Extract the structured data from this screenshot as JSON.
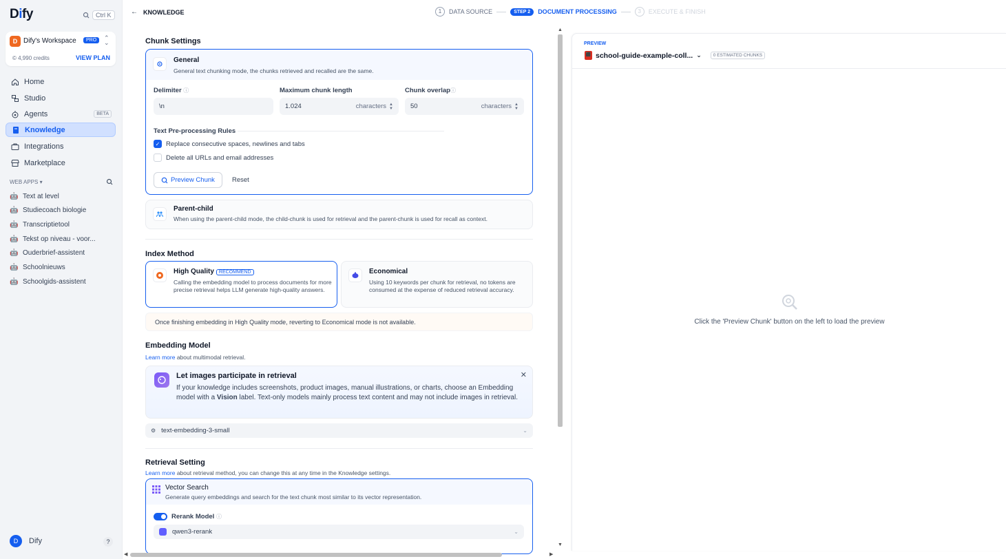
{
  "brand": {
    "name_prefix": "D",
    "name_i": "i",
    "name_suffix": "fy"
  },
  "search_shortcut": "Ctrl K",
  "workspace": {
    "initial": "D",
    "name": "Dify's Workspace",
    "badge": "PRO",
    "credits": "© 4,990 credits",
    "plan_link": "VIEW PLAN"
  },
  "nav": [
    {
      "label": "Home"
    },
    {
      "label": "Studio"
    },
    {
      "label": "Agents",
      "badge": "BETA"
    },
    {
      "label": "Knowledge"
    },
    {
      "label": "Integrations"
    },
    {
      "label": "Marketplace"
    }
  ],
  "web_apps": {
    "heading": "WEB APPS",
    "items": [
      "Text at level",
      "Studiecoach biologie",
      "Transcriptietool",
      "Tekst op niveau - voor...",
      "Ouderbrief-assistent",
      "Schoolnieuws",
      "Schoolgids-assistent"
    ]
  },
  "user": {
    "initial": "D",
    "name": "Dify",
    "help": "?"
  },
  "header": {
    "back": "←",
    "title": "KNOWLEDGE"
  },
  "steps": [
    {
      "num": "1",
      "label": "DATA SOURCE"
    },
    {
      "num": "STEP 2",
      "label": "DOCUMENT PROCESSING"
    },
    {
      "num": "3",
      "label": "EXECUTE & FINISH"
    }
  ],
  "chunk": {
    "heading": "Chunk Settings",
    "general": {
      "title": "General",
      "desc": "General text chunking mode, the chunks retrieved and recalled are the same."
    },
    "delimiter": {
      "label": "Delimiter",
      "value": "\\n"
    },
    "max_length": {
      "label": "Maximum chunk length",
      "value": "1.024",
      "unit": "characters"
    },
    "overlap": {
      "label": "Chunk overlap",
      "value": "50",
      "unit": "characters"
    },
    "rules_heading": "Text Pre-processing Rules",
    "rule1": "Replace consecutive spaces, newlines and tabs",
    "rule2": "Delete all URLs and email addresses",
    "preview_btn": "Preview Chunk",
    "reset_btn": "Reset",
    "parent_child": {
      "title": "Parent-child",
      "desc": "When using the parent-child mode, the child-chunk is used for retrieval and the parent-chunk is used for recall as context."
    }
  },
  "index": {
    "heading": "Index Method",
    "high": {
      "title": "High Quality",
      "badge": "RECOMMEND",
      "desc": "Calling the embedding model to process documents for more precise retrieval helps LLM generate high-quality answers."
    },
    "eco": {
      "title": "Economical",
      "desc": "Using 10 keywords per chunk for retrieval, no tokens are consumed at the expense of reduced retrieval accuracy."
    },
    "warning": "Once finishing embedding in High Quality mode, reverting to Economical mode is not available."
  },
  "embedding": {
    "heading": "Embedding Model",
    "learn_more": "Learn more",
    "sub": " about multimodal retrieval.",
    "banner_title": "Let images participate in retrieval",
    "banner_text_1": "If your knowledge includes screenshots, product images, manual illustrations, or charts, choose an Embedding model with a ",
    "banner_bold": "Vision",
    "banner_text_2": " label. Text-only models mainly process text content and may not include images in retrieval.",
    "model": "text-embedding-3-small"
  },
  "retrieval": {
    "heading": "Retrieval Setting",
    "learn_more": "Learn more",
    "sub": " about retrieval method, you can change this at any time in the Knowledge settings.",
    "vector_title": "Vector Search",
    "vector_desc": "Generate query embeddings and search for the text chunk most similar to its vector representation.",
    "rerank_label": "Rerank Model",
    "rerank_enabled": true,
    "rerank_model": "qwen3-rerank"
  },
  "preview": {
    "label": "PREVIEW",
    "file": "school-guide-example-coll...",
    "chunks": "0 ESTIMATED CHUNKS",
    "empty": "Click the 'Preview Chunk' button on the left to load the preview"
  },
  "colors": {
    "accent": "#155eef",
    "sidebar_bg": "#f2f4f7",
    "workspace_avatar": "#ef6820"
  }
}
